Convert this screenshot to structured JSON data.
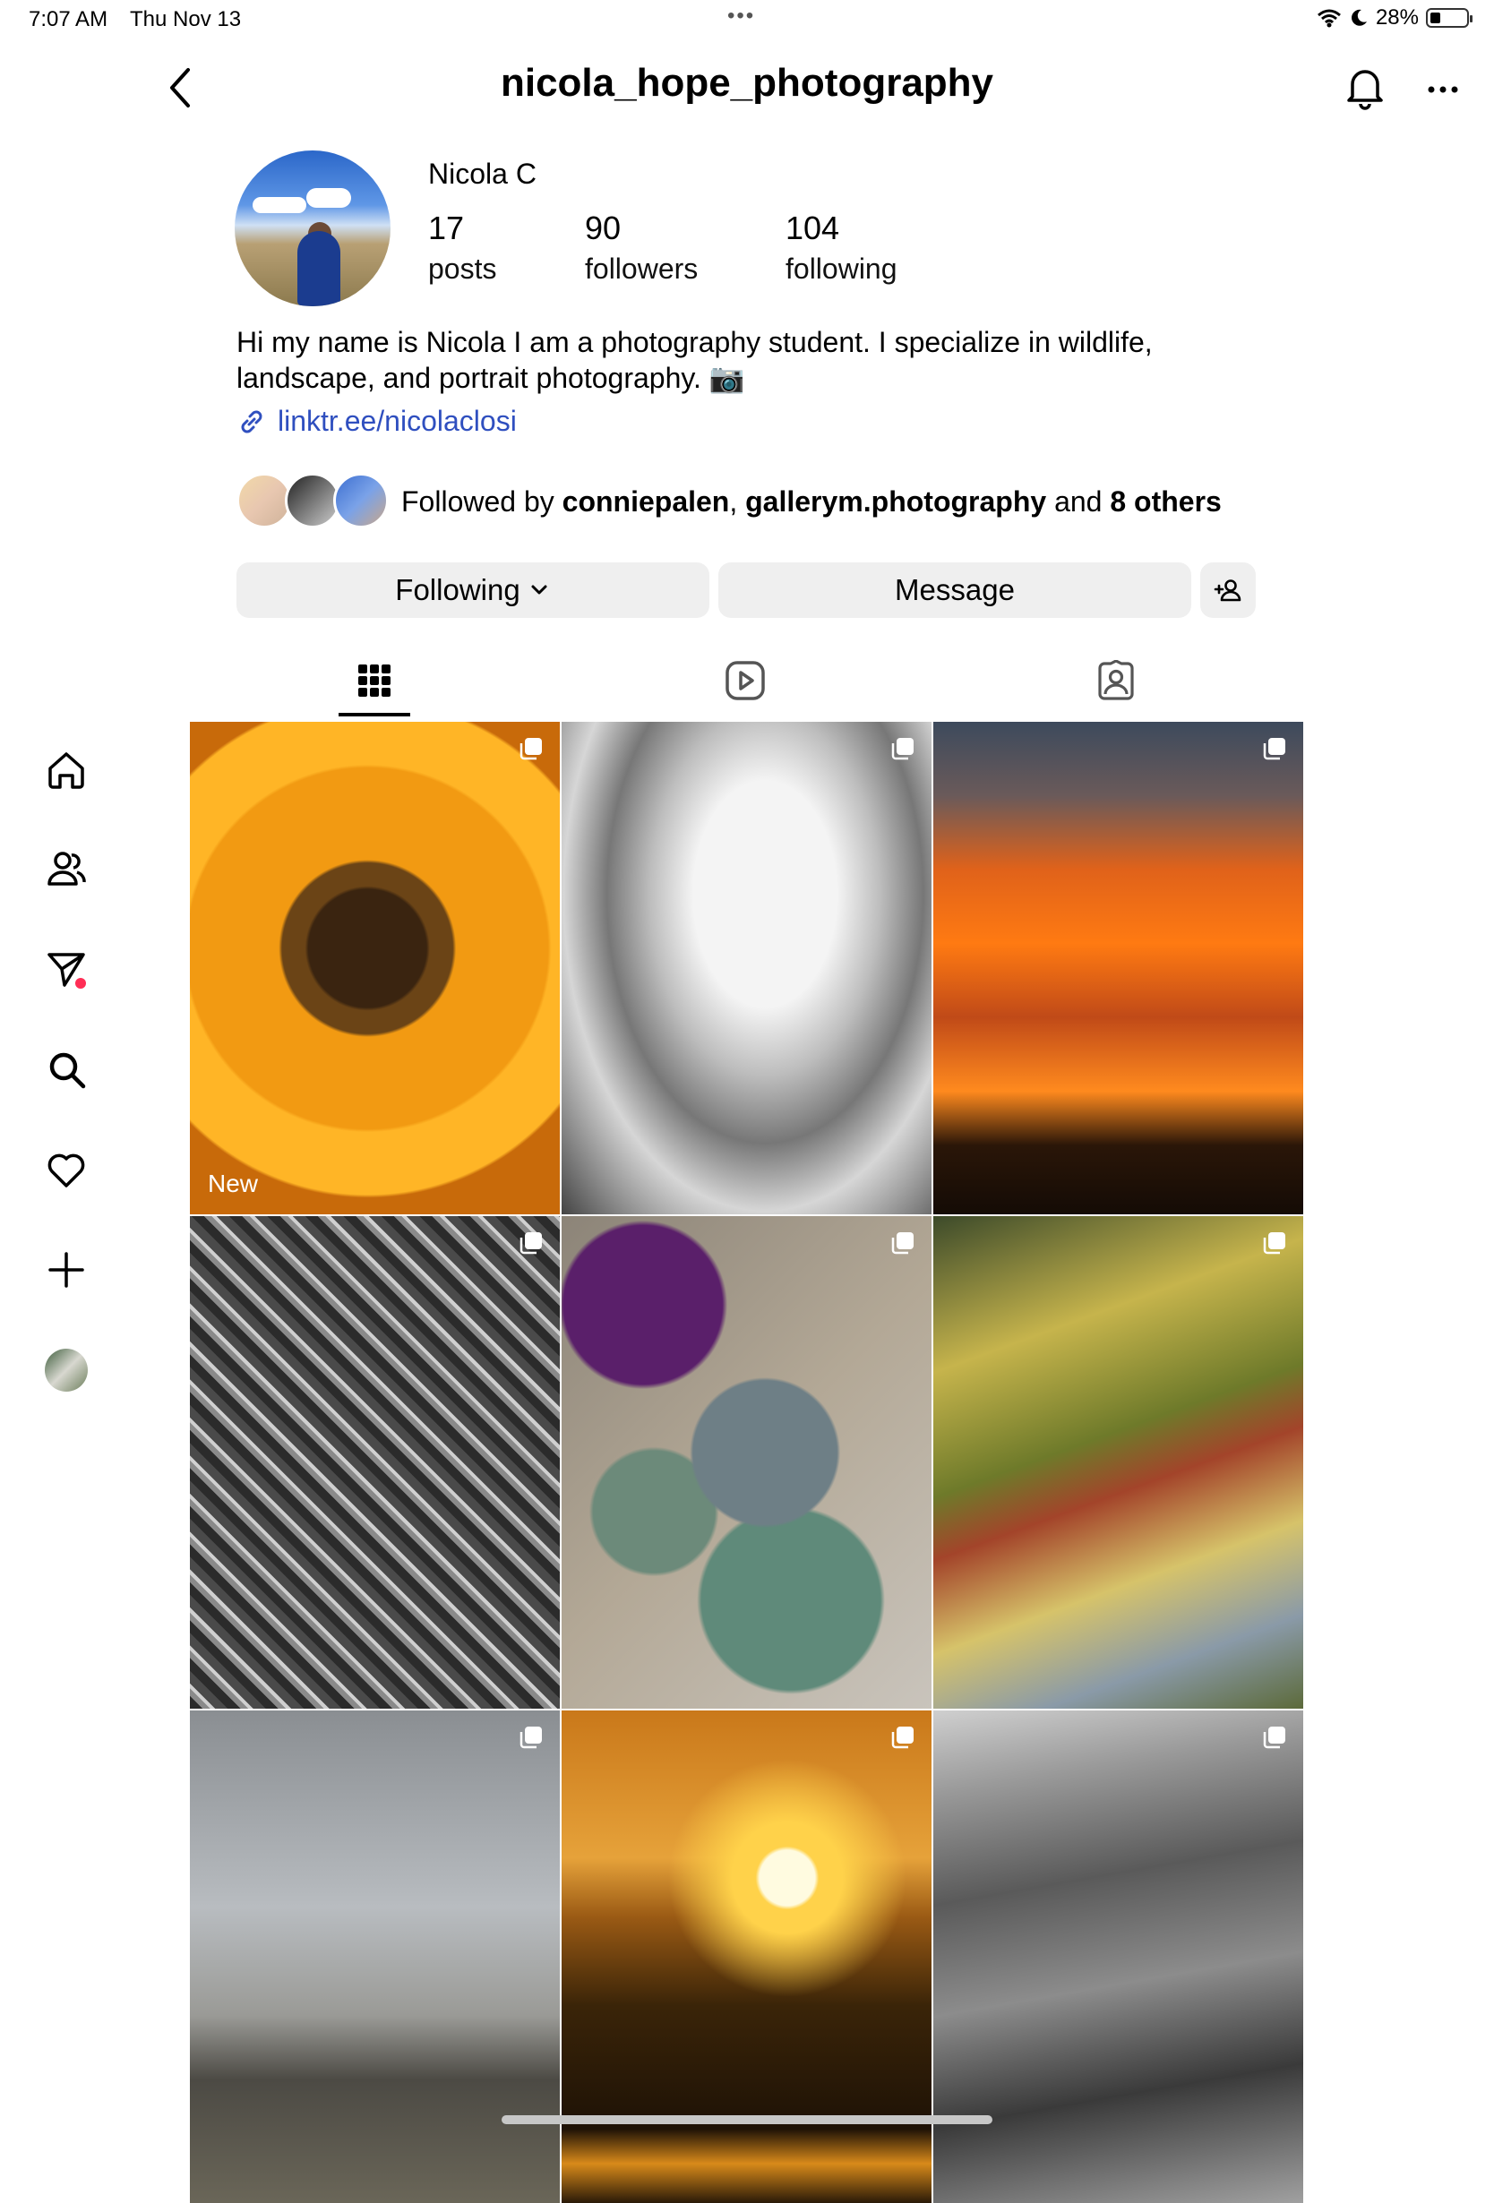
{
  "status_bar": {
    "time": "7:07 AM",
    "date": "Thu Nov 13",
    "battery_text": "28%",
    "battery_level": 0.28
  },
  "header": {
    "username": "nicola_hope_photography"
  },
  "profile": {
    "name": "Nicola C",
    "stats": [
      {
        "value": "17",
        "label": "posts"
      },
      {
        "value": "90",
        "label": "followers"
      },
      {
        "value": "104",
        "label": "following"
      }
    ],
    "bio_line1": "Hi my name is Nicola I am a photography student. I specialize in wildlife,",
    "bio_line2": "landscape, and portrait photography. 📷",
    "link": "linktr.ee/nicolaclosi",
    "followed_by": {
      "prefix": "Followed by ",
      "user1": "conniepalen",
      "separator": ", ",
      "user2": "gallerym.photography",
      "joiner": " and ",
      "others": "8 others"
    }
  },
  "buttons": {
    "following": "Following",
    "message": "Message"
  },
  "grid": {
    "new_label": "New",
    "posts": [
      {
        "subject": "sunflower",
        "multi": true
      },
      {
        "subject": "clouds black and white",
        "multi": true
      },
      {
        "subject": "orange sunset",
        "multi": true
      },
      {
        "subject": "cactus black and white",
        "multi": true
      },
      {
        "subject": "prickly pear cactus",
        "multi": true
      },
      {
        "subject": "desert plant",
        "multi": true
      },
      {
        "subject": "rain on window",
        "multi": true
      },
      {
        "subject": "sun over mountains",
        "multi": true
      },
      {
        "subject": "aerial terrain black and white",
        "multi": true
      }
    ]
  },
  "colors": {
    "link": "#2f4fbf",
    "button_bg": "#efefef",
    "notification_dot": "#ff2d55"
  }
}
